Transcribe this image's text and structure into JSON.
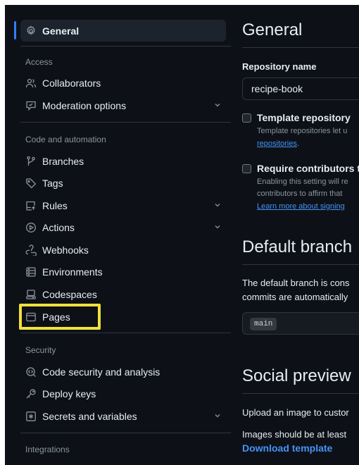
{
  "sidebar": {
    "general": {
      "label": "General",
      "icon": "gear-icon"
    },
    "sections": {
      "access": "Access",
      "code_automation": "Code and automation",
      "security": "Security",
      "integrations": "Integrations"
    },
    "access_items": [
      {
        "label": "Collaborators",
        "icon": "people-icon"
      },
      {
        "label": "Moderation options",
        "icon": "comment-icon",
        "expandable": true
      }
    ],
    "code_items": [
      {
        "label": "Branches",
        "icon": "git-branch-icon"
      },
      {
        "label": "Tags",
        "icon": "tag-icon"
      },
      {
        "label": "Rules",
        "icon": "repo-push-icon",
        "expandable": true
      },
      {
        "label": "Actions",
        "icon": "play-icon",
        "expandable": true
      },
      {
        "label": "Webhooks",
        "icon": "webhook-icon"
      },
      {
        "label": "Environments",
        "icon": "server-icon"
      },
      {
        "label": "Codespaces",
        "icon": "codespaces-icon"
      },
      {
        "label": "Pages",
        "icon": "browser-icon"
      }
    ],
    "security_items": [
      {
        "label": "Code security and analysis",
        "icon": "codescan-icon"
      },
      {
        "label": "Deploy keys",
        "icon": "key-icon"
      },
      {
        "label": "Secrets and variables",
        "icon": "asterisk-icon",
        "expandable": true
      }
    ]
  },
  "main": {
    "general_title": "General",
    "repo_name_label": "Repository name",
    "repo_name_value": "recipe-book",
    "template": {
      "title": "Template repository",
      "desc_line1": "Template repositories let u",
      "desc_link": "repositories",
      "desc_link_suffix": "."
    },
    "signoff": {
      "title": "Require contributors t",
      "desc_line1": "Enabling this setting will re",
      "desc_line2": "contributors to affirm that",
      "desc_link": "Learn more about signing"
    },
    "default_branch_title": "Default branch",
    "default_branch_line1": "The default branch is cons",
    "default_branch_line2": "commits are automatically",
    "default_branch_value": "main",
    "social_title": "Social preview",
    "social_line1": "Upload an image to custor",
    "social_line2": "Images should be at least",
    "download_template": "Download template"
  },
  "colors": {
    "background": "#0d1117",
    "accent": "#2f81f7",
    "link": "#4493f8",
    "highlight": "#f0e13b"
  }
}
